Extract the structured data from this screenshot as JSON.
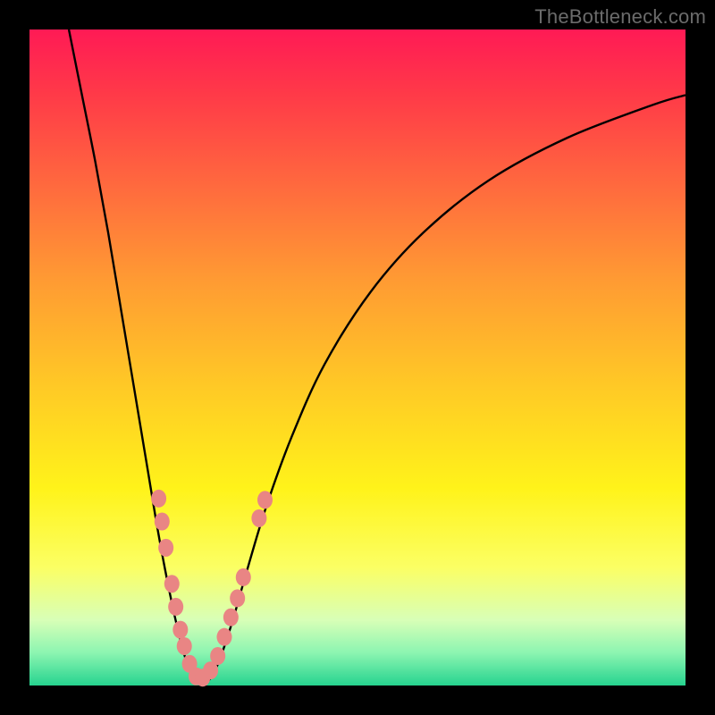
{
  "watermark": "TheBottleneck.com",
  "dot_color": "#e98584",
  "curve_color": "#000000",
  "chart_data": {
    "type": "line",
    "title": "",
    "xlabel": "",
    "ylabel": "",
    "x_range": [
      0,
      100
    ],
    "y_range": [
      0,
      100
    ],
    "series": [
      {
        "name": "curve",
        "points": [
          {
            "x": 6.0,
            "y": 100.0
          },
          {
            "x": 8.0,
            "y": 90.0
          },
          {
            "x": 10.0,
            "y": 80.0
          },
          {
            "x": 12.0,
            "y": 69.0
          },
          {
            "x": 14.0,
            "y": 57.0
          },
          {
            "x": 16.0,
            "y": 45.0
          },
          {
            "x": 18.0,
            "y": 33.0
          },
          {
            "x": 19.5,
            "y": 24.0
          },
          {
            "x": 21.0,
            "y": 16.0
          },
          {
            "x": 22.5,
            "y": 9.0
          },
          {
            "x": 24.0,
            "y": 3.5
          },
          {
            "x": 25.8,
            "y": 0.5
          },
          {
            "x": 27.5,
            "y": 1.0
          },
          {
            "x": 29.0,
            "y": 4.0
          },
          {
            "x": 31.0,
            "y": 10.0
          },
          {
            "x": 33.0,
            "y": 17.0
          },
          {
            "x": 36.0,
            "y": 27.0
          },
          {
            "x": 40.0,
            "y": 38.0
          },
          {
            "x": 45.0,
            "y": 49.0
          },
          {
            "x": 52.0,
            "y": 60.0
          },
          {
            "x": 60.0,
            "y": 69.0
          },
          {
            "x": 70.0,
            "y": 77.0
          },
          {
            "x": 82.0,
            "y": 83.5
          },
          {
            "x": 95.0,
            "y": 88.5
          },
          {
            "x": 100.0,
            "y": 90.0
          }
        ]
      }
    ],
    "markers": [
      {
        "x": 19.7,
        "y": 28.5
      },
      {
        "x": 20.2,
        "y": 25.0
      },
      {
        "x": 20.8,
        "y": 21.0
      },
      {
        "x": 21.7,
        "y": 15.5
      },
      {
        "x": 22.3,
        "y": 12.0
      },
      {
        "x": 23.0,
        "y": 8.5
      },
      {
        "x": 23.6,
        "y": 6.0
      },
      {
        "x": 24.4,
        "y": 3.3
      },
      {
        "x": 25.4,
        "y": 1.4
      },
      {
        "x": 26.4,
        "y": 1.2
      },
      {
        "x": 27.6,
        "y": 2.3
      },
      {
        "x": 28.7,
        "y": 4.5
      },
      {
        "x": 29.7,
        "y": 7.4
      },
      {
        "x": 30.7,
        "y": 10.4
      },
      {
        "x": 31.7,
        "y": 13.3
      },
      {
        "x": 32.6,
        "y": 16.5
      },
      {
        "x": 35.0,
        "y": 25.5
      },
      {
        "x": 35.9,
        "y": 28.3
      }
    ]
  }
}
